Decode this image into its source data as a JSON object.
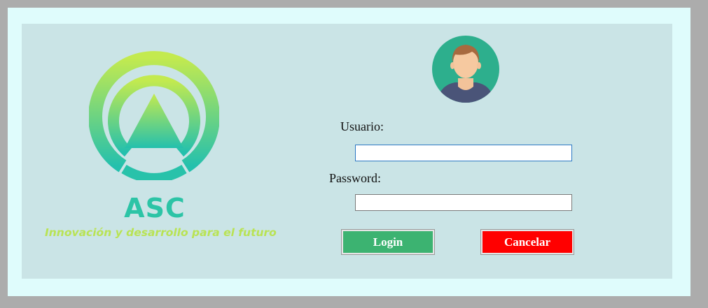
{
  "brand": {
    "name": "ASC",
    "tagline": "Innovación y desarrollo para el futuro",
    "logo_icon": "asc-logo-icon"
  },
  "avatar_icon": "user-avatar-icon",
  "form": {
    "username_label": "Usuario:",
    "username_value": "",
    "password_label": "Password:",
    "password_value": ""
  },
  "buttons": {
    "login_label": "Login",
    "cancel_label": "Cancelar"
  },
  "colors": {
    "background": "#acacac",
    "frame": "#dffcfc",
    "panel": "#cae4e6",
    "login": "#3cb371",
    "cancel": "#ff0000",
    "brand_teal": "#2cc4a6",
    "brand_lime": "#b9e354"
  }
}
